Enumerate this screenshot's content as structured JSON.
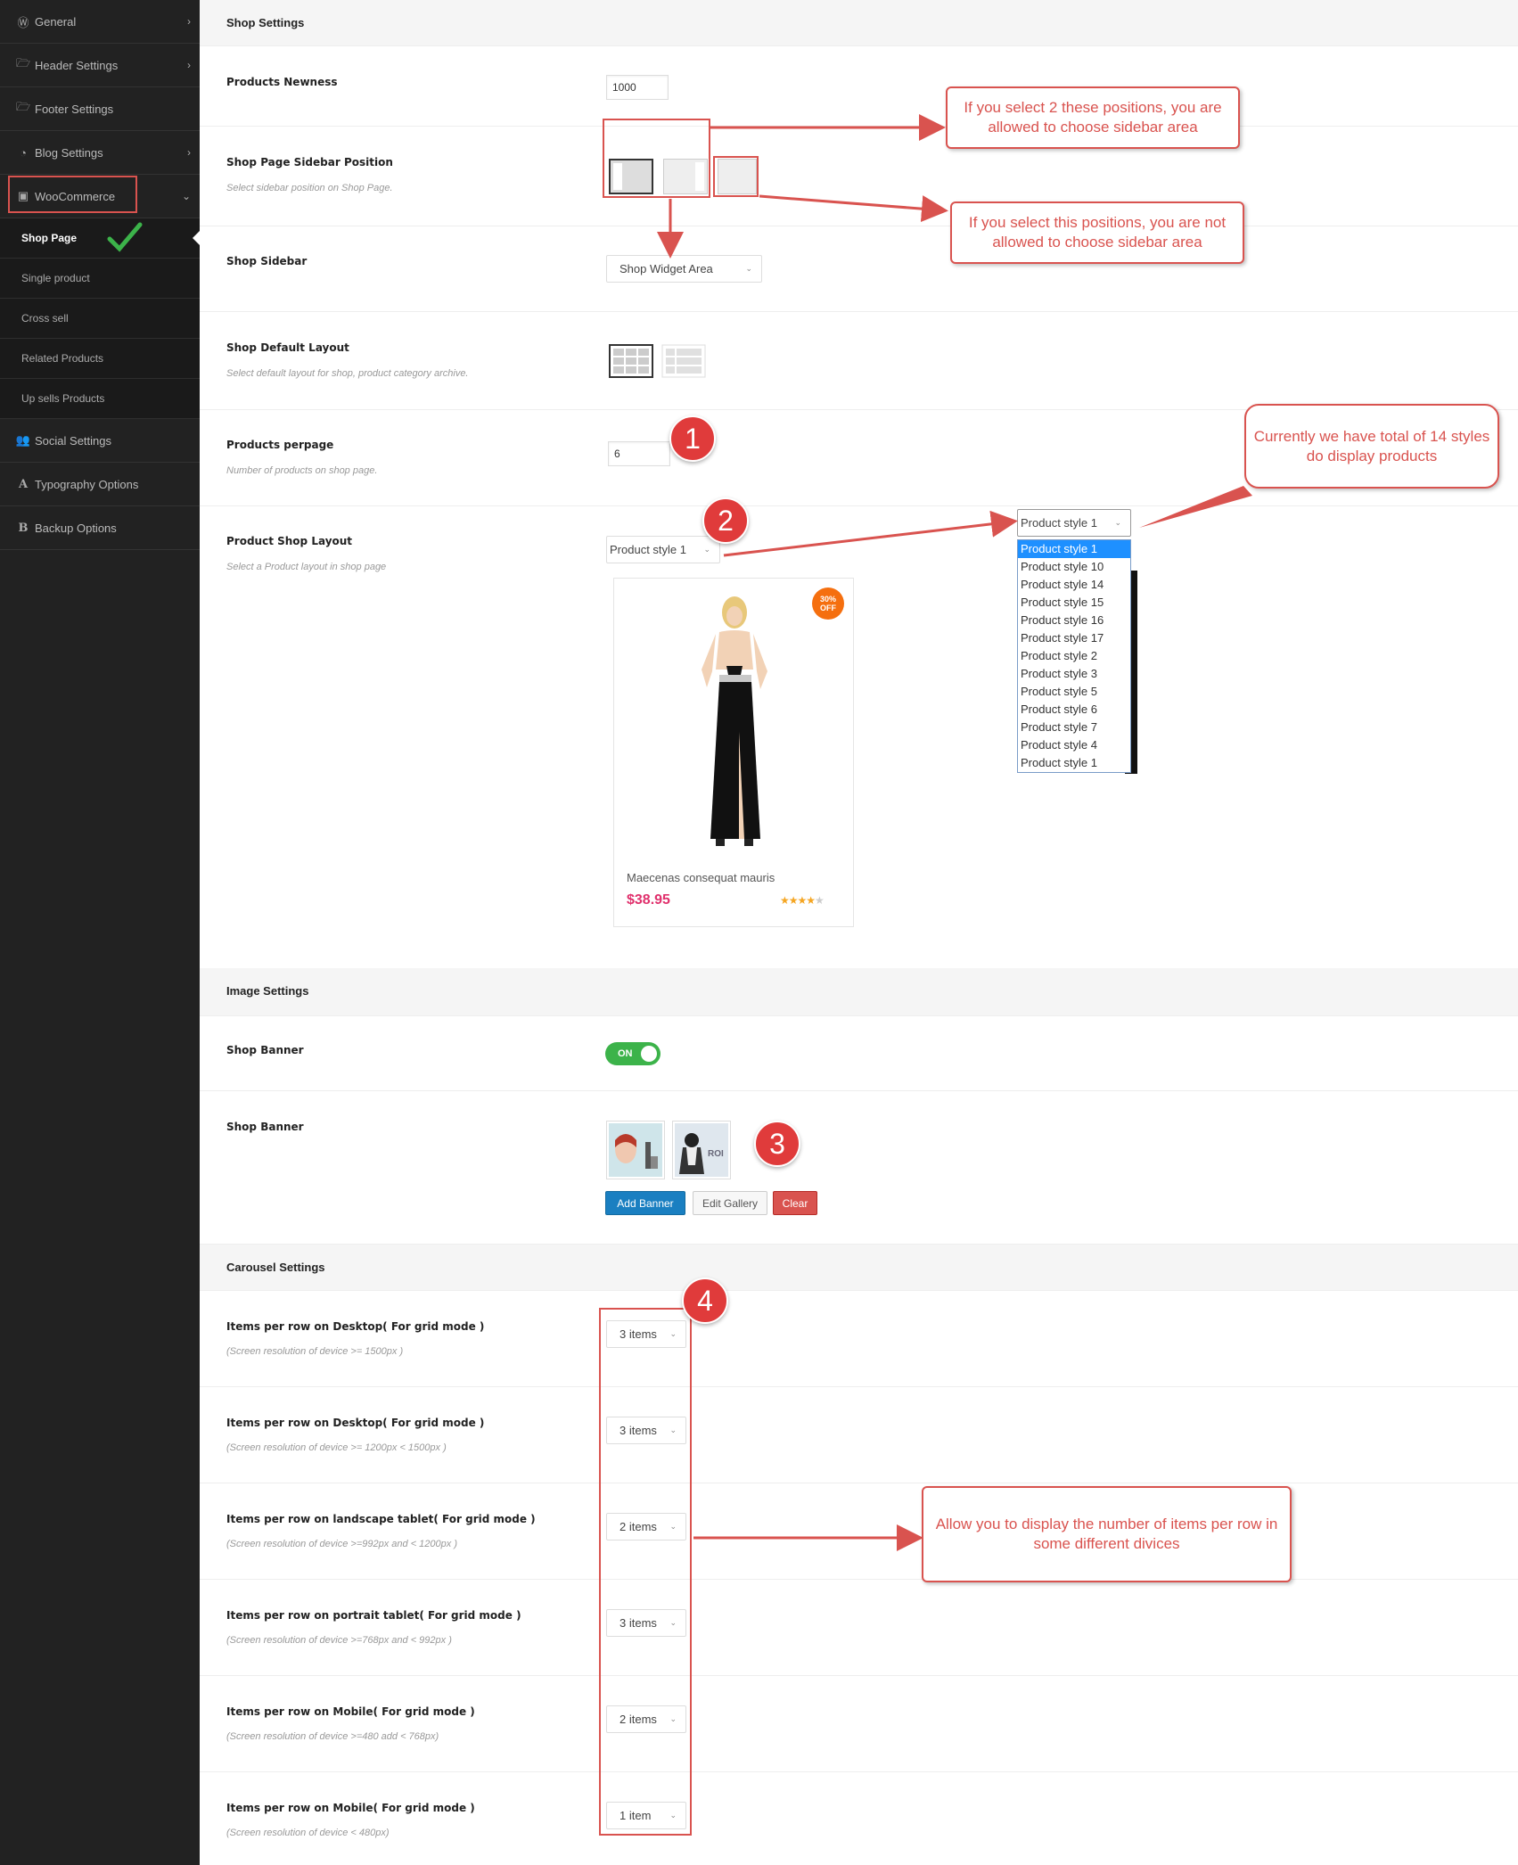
{
  "sidebar": {
    "items": [
      {
        "label": "General",
        "icon": "wordpress-icon"
      },
      {
        "label": "Header Settings",
        "icon": "folder-open-icon"
      },
      {
        "label": "Footer Settings",
        "icon": "folder-open-icon"
      },
      {
        "label": "Blog Settings",
        "icon": "rss-icon"
      },
      {
        "label": "WooCommerce",
        "icon": "shopping-bag-icon"
      }
    ],
    "sub_items": [
      "Shop Page",
      "Single product",
      "Cross sell",
      "Related Products",
      "Up sells Products"
    ],
    "bottom_items": [
      {
        "label": "Social Settings",
        "icon": "users-icon"
      },
      {
        "label": "Typography Options",
        "icon": "font-icon"
      },
      {
        "label": "Backup Options",
        "icon": "bold-b-icon"
      }
    ]
  },
  "shop_settings": {
    "title": "Shop Settings",
    "newness": {
      "label": "Products Newness",
      "value": "1000"
    },
    "sidebar_position": {
      "label": "Shop Page Sidebar Position",
      "desc": "Select sidebar position on Shop Page."
    },
    "shop_sidebar": {
      "label": "Shop Sidebar",
      "value": "Shop Widget Area"
    },
    "default_layout": {
      "label": "Shop Default Layout",
      "desc": "Select default layout for shop, product category archive."
    },
    "perpage": {
      "label": "Products perpage",
      "desc": "Number of products on shop page.",
      "value": "6"
    },
    "shop_layout": {
      "label": "Product Shop Layout",
      "desc": "Select a Product layout in shop page",
      "value": "Product style 1"
    }
  },
  "product_preview": {
    "name": "Maecenas consequat mauris",
    "price": "$38.95",
    "sale_badge": "30%\nOFF",
    "rating": 4,
    "price_color": "#e0306c"
  },
  "style_dropdown": {
    "selected": "Product style 1",
    "options": [
      "Product style 1",
      "Product style 10",
      "Product style 14",
      "Product style 15",
      "Product style 16",
      "Product style 17",
      "Product style 2",
      "Product style 3",
      "Product style 5",
      "Product style 6",
      "Product style 7",
      "Product style 4",
      "Product style 1"
    ]
  },
  "image_settings": {
    "title": "Image Settings",
    "banner_toggle": {
      "label": "Shop Banner",
      "value": "ON"
    },
    "banner_gallery": {
      "label": "Shop Banner",
      "add": "Add Banner",
      "edit": "Edit Gallery",
      "clear": "Clear"
    }
  },
  "carousel_settings": {
    "title": "Carousel Settings",
    "rows": [
      {
        "label": "Items per row on Desktop( For grid mode )",
        "desc": "(Screen resolution of device >= 1500px )",
        "value": "3 items"
      },
      {
        "label": "Items per row on Desktop( For grid mode )",
        "desc": "(Screen resolution of device >= 1200px < 1500px )",
        "value": "3 items"
      },
      {
        "label": "Items per row on landscape tablet( For grid mode )",
        "desc": "(Screen resolution of device >=992px and < 1200px )",
        "value": "2 items"
      },
      {
        "label": "Items per row on portrait tablet( For grid mode )",
        "desc": "(Screen resolution of device >=768px and < 992px )",
        "value": "3 items"
      },
      {
        "label": "Items per row on Mobile( For grid mode )",
        "desc": "(Screen resolution of device >=480 add < 768px)",
        "value": "2 items"
      },
      {
        "label": "Items per row on Mobile( For grid mode )",
        "desc": "(Screen resolution of device < 480px)",
        "value": "1 item"
      }
    ]
  },
  "annotations": {
    "callout1": "If you select 2 these positions, you are allowed to choose sidebar area",
    "callout2": "If you select this positions, you are not allowed to choose sidebar area",
    "callout3": "Currently we have total of 14 styles do display products",
    "callout4": "Allow you to display the number of items per row in some different divices",
    "badges": [
      "1",
      "2",
      "3",
      "4"
    ],
    "accent_color": "#d9534f"
  }
}
